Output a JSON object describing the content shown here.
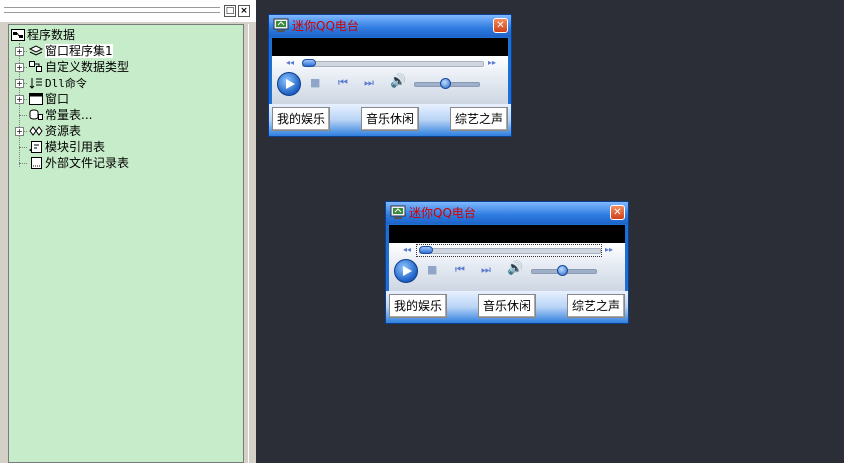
{
  "tree": {
    "root": "程序数据",
    "items": [
      {
        "label": "窗口程序集1",
        "expandable": true
      },
      {
        "label": "自定义数据类型",
        "expandable": true
      },
      {
        "label": "Dll命令",
        "expandable": true
      },
      {
        "label": "窗口",
        "expandable": true
      },
      {
        "label": "常量表...",
        "expandable": false
      },
      {
        "label": "资源表",
        "expandable": true
      },
      {
        "label": "模块引用表",
        "expandable": false
      },
      {
        "label": "外部文件记录表",
        "expandable": false
      }
    ]
  },
  "panel_buttons": {
    "restore": "□",
    "close": "×"
  },
  "windows": [
    {
      "title": "迷你QQ电台",
      "buttons": [
        "我的娱乐",
        "音乐休闲",
        "综艺之声"
      ]
    },
    {
      "title": "迷你QQ电台",
      "buttons": [
        "我的娱乐",
        "音乐休闲",
        "综艺之声"
      ]
    }
  ],
  "colors": {
    "tree_bg": "#c7ecc9",
    "title_text": "#d20000",
    "desktop_bg": "#2b2e36"
  }
}
